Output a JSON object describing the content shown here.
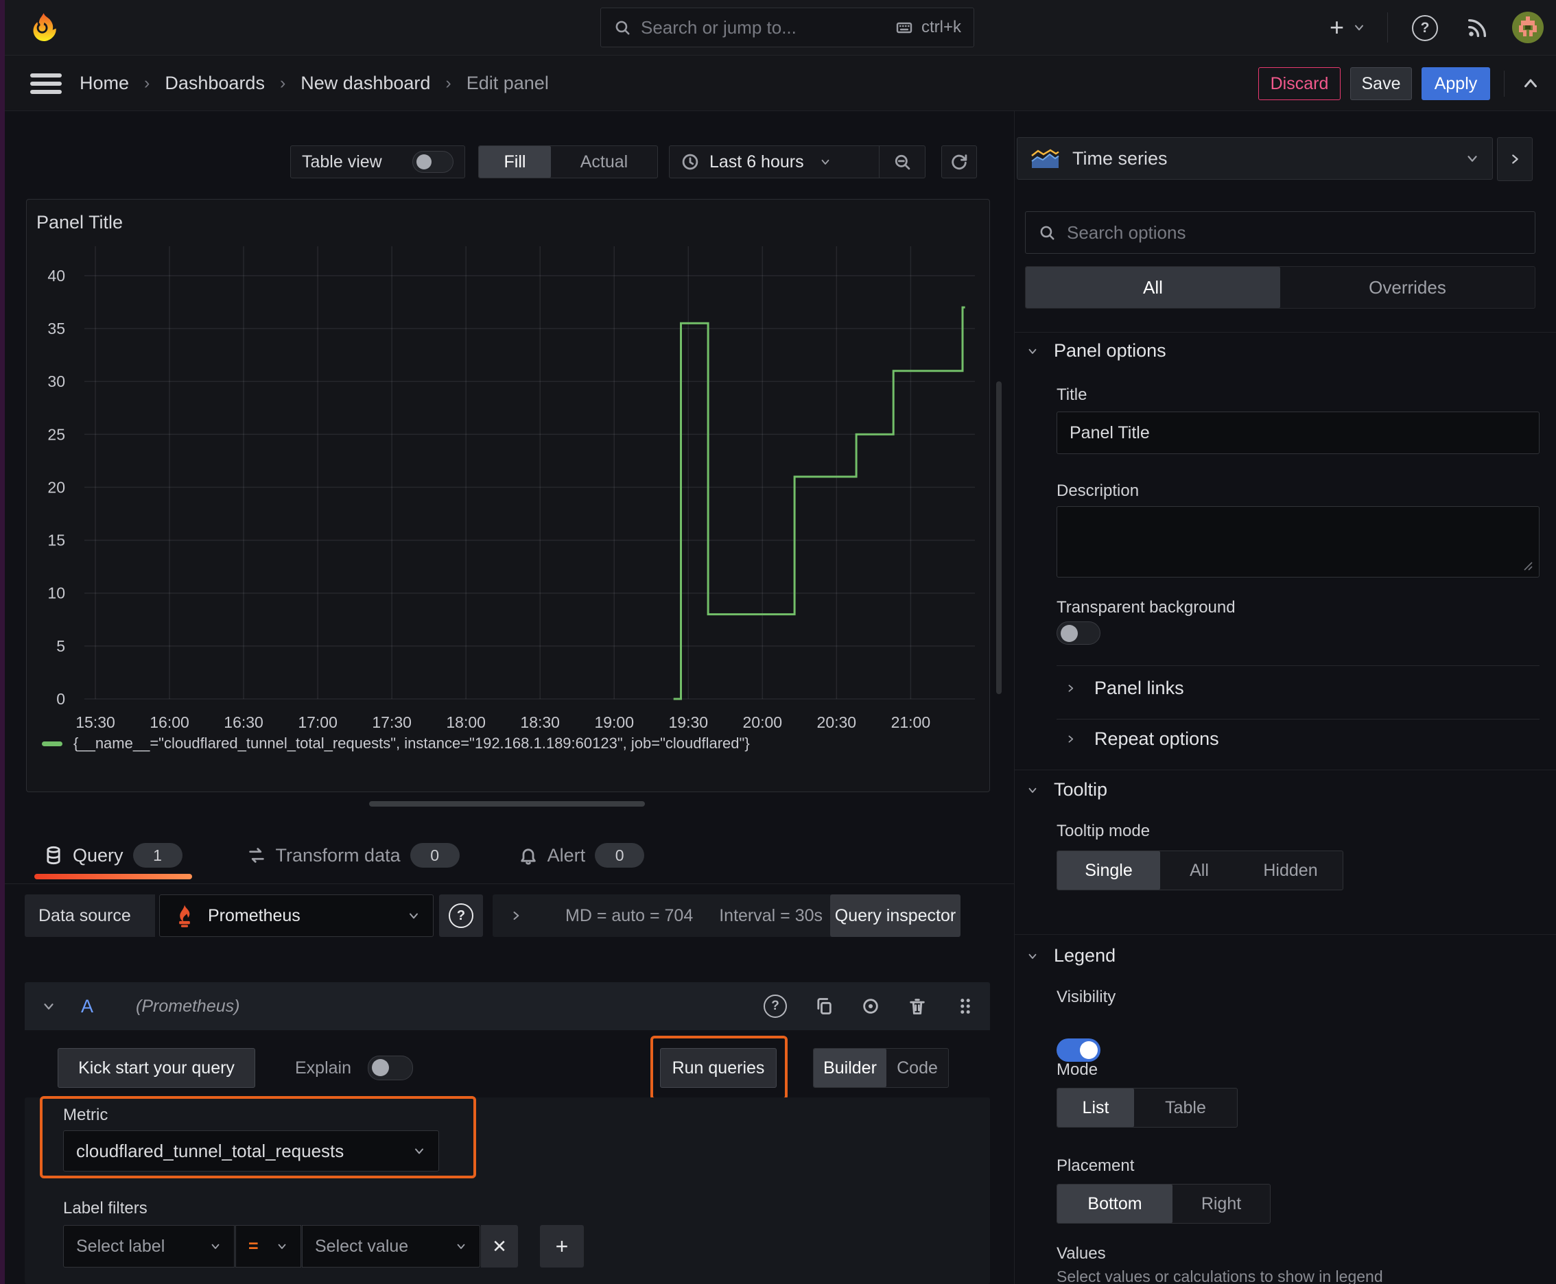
{
  "topbar": {
    "search": {
      "placeholder": "Search or jump to...",
      "shortcut": "ctrl+k"
    }
  },
  "icons": {
    "new": "+",
    "help": "?",
    "breadcrumb_separator": "›",
    "remove_filter": "✕",
    "add_filter": "+"
  },
  "breadcrumb": {
    "items": [
      "Home",
      "Dashboards",
      "New dashboard",
      "Edit panel"
    ]
  },
  "actions": {
    "discard": "Discard",
    "save": "Save",
    "apply": "Apply"
  },
  "toolbar": {
    "table_view": "Table view",
    "fill": "Fill",
    "actual": "Actual",
    "time_range": "Last 6 hours"
  },
  "viz_picker": {
    "label": "Time series"
  },
  "options": {
    "search_placeholder": "Search options",
    "tabs": {
      "all": "All",
      "overrides": "Overrides"
    },
    "panel_options": {
      "header": "Panel options",
      "title_label": "Title",
      "title_value": "Panel Title",
      "description_label": "Description",
      "transparent_label": "Transparent background"
    },
    "collapsed": {
      "panel_links": "Panel links",
      "repeat_options": "Repeat options"
    },
    "tooltip": {
      "header": "Tooltip",
      "mode_label": "Tooltip mode",
      "modes": [
        "Single",
        "All",
        "Hidden"
      ],
      "selected": "Single"
    },
    "legend": {
      "header": "Legend",
      "visibility_label": "Visibility",
      "mode_label": "Mode",
      "modes": [
        "List",
        "Table"
      ],
      "selected_mode": "List",
      "placement_label": "Placement",
      "placements": [
        "Bottom",
        "Right"
      ],
      "selected_placement": "Bottom",
      "values_label": "Values",
      "values_help": "Select values or calculations to show in legend"
    }
  },
  "panel": {
    "title": "Panel Title"
  },
  "chart_data": {
    "type": "line",
    "step": true,
    "title": "Panel Title",
    "grid": true,
    "legend_position": "bottom",
    "colors": {
      "line": "#73bf69",
      "grid": "rgba(204,204,220,0.10)",
      "tick_label": "#c8c9cf"
    },
    "x_axis": {
      "ticks": [
        "15:30",
        "16:00",
        "16:30",
        "17:00",
        "17:30",
        "18:00",
        "18:30",
        "19:00",
        "19:30",
        "20:00",
        "20:30",
        "21:00"
      ],
      "tick_minutes": [
        0,
        30,
        60,
        90,
        120,
        150,
        180,
        210,
        240,
        270,
        300,
        330
      ],
      "range_minutes": [
        -10,
        356
      ]
    },
    "y_axis": {
      "ticks": [
        0,
        5,
        10,
        15,
        20,
        25,
        30,
        35,
        40
      ],
      "range": [
        0,
        42
      ]
    },
    "series": [
      {
        "name": "{__name__=\"cloudflared_tunnel_total_requests\", instance=\"192.168.1.189:60123\", job=\"cloudflared\"}",
        "color": "#73bf69",
        "points": [
          [
            234,
            0
          ],
          [
            237,
            0
          ],
          [
            237,
            35.5
          ],
          [
            248,
            35.5
          ],
          [
            248,
            8
          ],
          [
            283,
            8
          ],
          [
            283,
            21
          ],
          [
            308,
            21
          ],
          [
            308,
            25
          ],
          [
            323,
            25
          ],
          [
            323,
            31
          ],
          [
            351,
            31
          ],
          [
            351,
            37
          ],
          [
            352,
            37
          ]
        ]
      }
    ]
  },
  "query_section": {
    "tabs": [
      {
        "label": "Query",
        "count": "1"
      },
      {
        "label": "Transform data",
        "count": "0"
      },
      {
        "label": "Alert",
        "count": "0"
      }
    ],
    "datasource": {
      "label": "Data source",
      "name": "Prometheus",
      "stats_md": "MD = auto = 704",
      "stats_interval": "Interval = 30s",
      "inspector": "Query inspector"
    },
    "query_row": {
      "ref": "A",
      "ds_hint": "(Prometheus)"
    },
    "builder": {
      "kick_start": "Kick start your query",
      "explain": "Explain",
      "run": "Run queries",
      "builder": "Builder",
      "code": "Code",
      "metric_label": "Metric",
      "metric_value": "cloudflared_tunnel_total_requests",
      "label_filters": "Label filters",
      "select_label": "Select label",
      "operator": "=",
      "select_value": "Select value"
    }
  }
}
